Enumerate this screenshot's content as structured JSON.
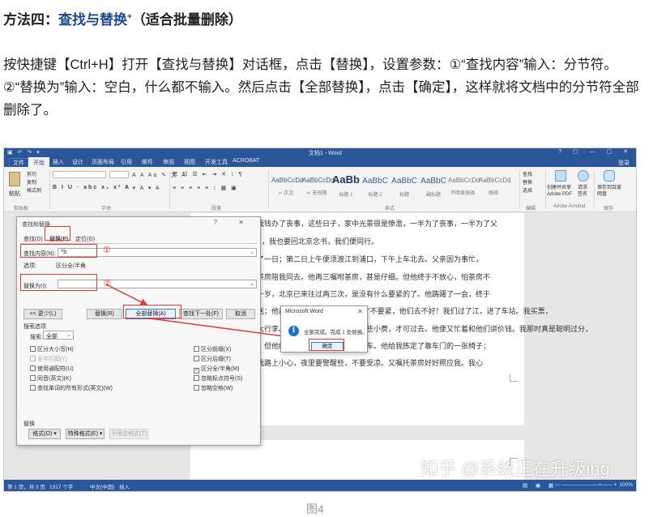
{
  "article": {
    "heading_prefix": "方法四：",
    "heading_highlight": "查找与替换",
    "heading_sup": "+",
    "heading_suffix": "（适合批量删除）",
    "paragraph": "按快捷键【Ctrl+H】打开【查找与替换】对话框，点击【替换】，设置参数：①“查找内容”输入：分节符。②“替换为”输入：空白，什么都不输入。然后点击【全部替换】，点击【确定】，这样就将文档中的分节符全部删除了。",
    "caption": "图4"
  },
  "word": {
    "doc_title": "文档1 - Word",
    "login": "登录",
    "tabs": [
      "文件",
      "开始",
      "插入",
      "设计",
      "页面布局",
      "引用",
      "邮件",
      "审阅",
      "视图",
      "开发工具",
      "ACROBAT"
    ],
    "active_tab": "开始",
    "ribbon": {
      "clipboard": {
        "paste": "粘贴",
        "cut": "剪切",
        "copy": "复制",
        "format_painter": "格式刷",
        "label": "剪贴板"
      },
      "font_label": "字体",
      "paragraph_label": "段落",
      "styles_label": "样式",
      "styles": [
        {
          "preview": "AaBbCcDd",
          "name": "↵ 正文"
        },
        {
          "preview": "AaBbCcDd",
          "name": "↵ 无间隔"
        },
        {
          "preview": "AaBb",
          "name": "标题 1"
        },
        {
          "preview": "AaBbC",
          "name": "标题 2"
        },
        {
          "preview": "AaBbC",
          "name": "标题"
        },
        {
          "preview": "AaBbC",
          "name": "副标题"
        },
        {
          "preview": "AaBbCcDd",
          "name": "不明显强调"
        },
        {
          "preview": "AaBbCcDd",
          "name": "强调"
        }
      ],
      "editing": {
        "find": "查找",
        "replace": "替换",
        "select": "选择",
        "label": "编辑"
      },
      "acrobat": {
        "create_pdf": "创建并共享 Adobe PDF",
        "request_sign": "请求签名",
        "label": "Adobe Acrobat"
      },
      "baidu": {
        "save": "保存到百度网盘",
        "label": "保存"
      }
    },
    "document_lines": [
      "我钱办了丧事，这些日子，家中光景很是惨澹，一半为了丧事，一半为了父",
      "，我也要回北京念书，我们便同行。",
      "了一日；第二日上午便须渡江到浦口，下午上车北去。父亲因为事忙，",
      "茶房陪我同去。他再三嘱咐茶房，甚是仔细。但他终于不放心，怕茶房不",
      "十岁，北京已来往过两三次，是没有什么要紧的了。他踌躇了一会，终于",
      "送；他再三劝他不必去；他只说，“不要紧，他们去不好！我们过了江，进了车站。我买票，",
      "太行李。行李太多了，得向脚夫行些小费，才可过去。他便又忙着和他们讲价钱。我那时真是聪明过分，",
      "，但他终于讲定了价钱；就送我上车。他给我拣定了靠车门的一张椅子；",
      "我路上小心，夜里要警醒些，不要受凉。又嘱托茶房好好照应我。我心"
    ],
    "status": {
      "page": "第 1 页，共 3 页",
      "words": "1317 个字",
      "lang": "中文(中国)",
      "mode": "插入",
      "zoom": "100%"
    }
  },
  "find_dialog": {
    "title": "查找和替换",
    "tabs": [
      "查找(D)",
      "替换(P)",
      "定位(G)"
    ],
    "active_tab": "替换(P)",
    "find_label": "查找内容(N):",
    "find_value": "^b",
    "options_label": "选项:",
    "options_value": "区分全/半角",
    "replace_label": "替换为(I):",
    "replace_value": "",
    "buttons": {
      "less": "<< 更少(L)",
      "replace": "替换(R)",
      "replace_all": "全部替换(A)",
      "find_next": "查找下一处(F)",
      "cancel": "取消"
    },
    "search_options_label": "搜索选项",
    "search_label": "搜索:",
    "search_value": "全部",
    "left_checks": [
      {
        "label": "区分大小写(H)",
        "checked": false,
        "disabled": false
      },
      {
        "label": "全字匹配(Y)",
        "checked": false,
        "disabled": true
      },
      {
        "label": "使用通配符(U)",
        "checked": false,
        "disabled": false
      },
      {
        "label": "同音(英文)(K)",
        "checked": false,
        "disabled": false
      },
      {
        "label": "查找单词的所有形式(英文)(W)",
        "checked": false,
        "disabled": false
      }
    ],
    "right_checks": [
      {
        "label": "区分前缀(X)",
        "checked": false
      },
      {
        "label": "区分后缀(T)",
        "checked": false
      },
      {
        "label": "区分全/半角(M)",
        "checked": true
      },
      {
        "label": "忽略标点符号(S)",
        "checked": false
      },
      {
        "label": "忽略空格(W)",
        "checked": false
      }
    ],
    "replace_section_label": "替换",
    "bottom_buttons": {
      "format": "格式(O) ▾",
      "special": "特殊格式(E) ▾",
      "no_format": "不限定格式(T)"
    }
  },
  "message_box": {
    "title": "Microsoft Word",
    "body": "全部完成。完成 1 处替换。",
    "ok": "确定"
  },
  "annotations": {
    "mark1": "①",
    "mark2": "②"
  },
  "watermark": "知乎 @系统正在升级ing",
  "colors": {
    "word_blue": "#2b579a",
    "annotation_red": "#e53935",
    "heading_blue": "#1e4a8c"
  }
}
